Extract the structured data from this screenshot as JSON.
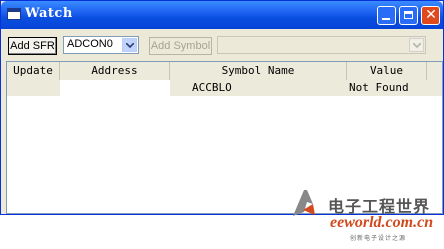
{
  "window": {
    "title": "Watch"
  },
  "toolbar": {
    "add_sfr_label": "Add SFR",
    "sfr_select_value": "ADCON0",
    "add_symbol_label": "Add Symbol",
    "symbol_select_value": ""
  },
  "table": {
    "columns": [
      "Update",
      "Address",
      "Symbol Name",
      "Value"
    ],
    "rows": [
      {
        "update": "",
        "address": "",
        "symbol_name": "ACCBLO",
        "value": "Not Found"
      }
    ]
  },
  "watermark": {
    "brand_cn": "电子工程世界",
    "brand_en": "eeworld.com.cn",
    "tagline": "创新电子设计之源"
  },
  "colors": {
    "titlebar": "#0a4fe0",
    "close_button": "#e0491d",
    "window_bg": "#ece9d8",
    "header_bg": "#ebeadb",
    "watermark_accent": "#d24a1e"
  }
}
